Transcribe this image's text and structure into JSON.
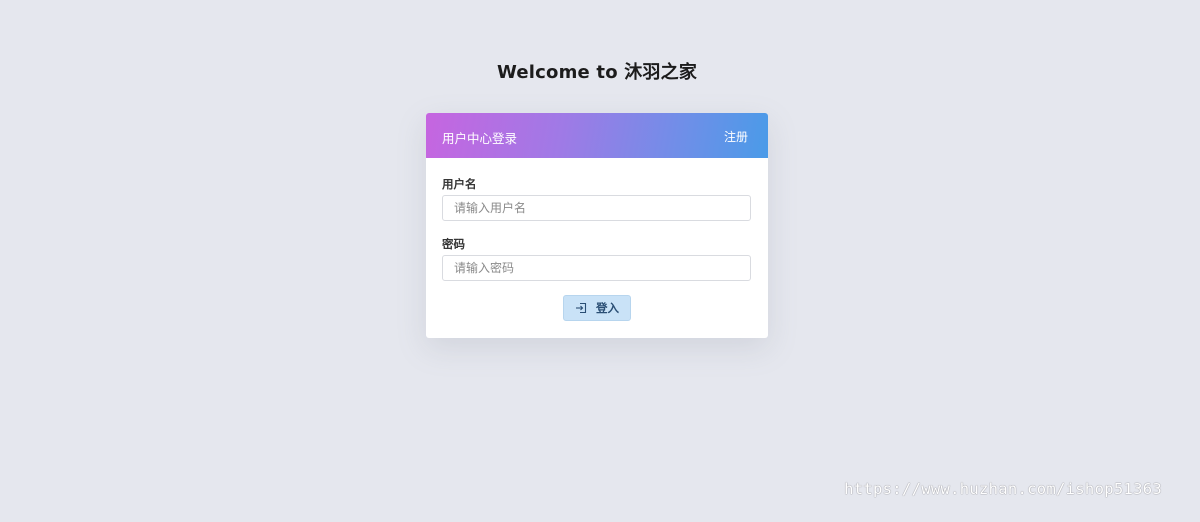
{
  "page": {
    "title": "Welcome to 沐羽之家"
  },
  "login_card": {
    "header_title": "用户中心登录",
    "register_link": "注册",
    "username": {
      "label": "用户名",
      "placeholder": "请输入用户名",
      "value": ""
    },
    "password": {
      "label": "密码",
      "placeholder": "请输入密码",
      "value": ""
    },
    "submit": {
      "label": "登入",
      "icon": "sign-in-icon"
    }
  },
  "watermark": "https://www.huzhan.com/ishop51363",
  "colors": {
    "background": "#e5e7ee",
    "header_gradient_start": "#c665e0",
    "header_gradient_end": "#4a9be8",
    "button_background": "#c9e2f7",
    "button_text": "#2a4e74"
  }
}
